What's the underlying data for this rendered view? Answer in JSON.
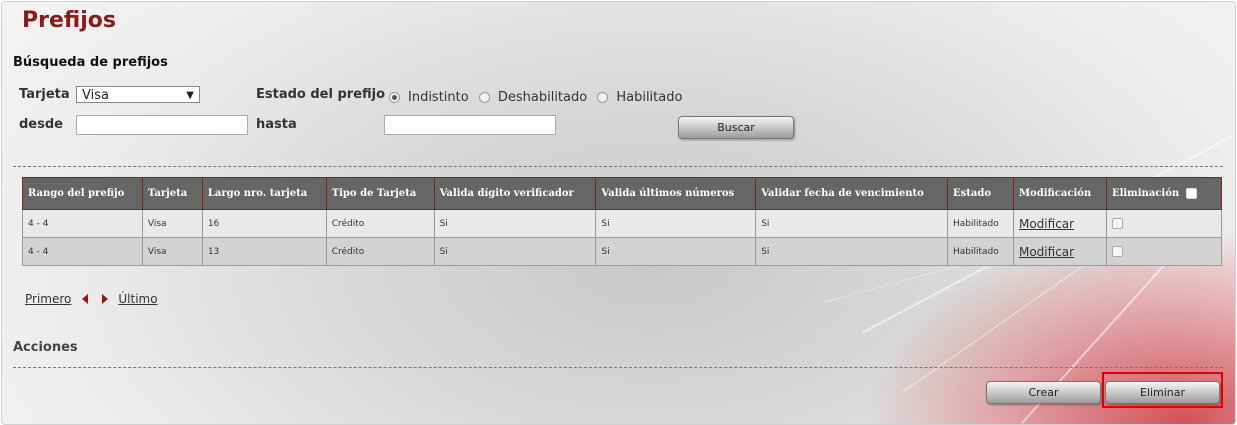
{
  "page_title": "Prefijos",
  "search": {
    "heading": "Búsqueda de prefijos",
    "tarjeta_label": "Tarjeta",
    "tarjeta_value": "Visa",
    "estado_label": "Estado del prefijo",
    "estado_options": [
      "Indistinto",
      "Deshabilitado",
      "Habilitado"
    ],
    "estado_selected": "Indistinto",
    "desde_label": "desde",
    "hasta_label": "hasta",
    "desde_value": "",
    "hasta_value": "",
    "buscar_label": "Buscar"
  },
  "table": {
    "headers": [
      "Rango del prefijo",
      "Tarjeta",
      "Largo nro. tarjeta",
      "Tipo de Tarjeta",
      "Valida dígito verificador",
      "Valida últimos números",
      "Validar fecha de vencimiento",
      "Estado",
      "Modificación",
      "Eliminación"
    ],
    "rows": [
      [
        "4 - 4",
        "Visa",
        "16",
        "Crédito",
        "Si",
        "Si",
        "Si",
        "Habilitado",
        "Modificar"
      ],
      [
        "4 - 4",
        "Visa",
        "13",
        "Crédito",
        "Si",
        "Si",
        "Si",
        "Habilitado",
        "Modificar"
      ]
    ]
  },
  "pager": {
    "first": "Primero",
    "last": "Último"
  },
  "actions": {
    "heading": "Acciones",
    "crear_label": "Crear",
    "eliminar_label": "Eliminar"
  },
  "colors": {
    "title": "#8b1a1a",
    "highlight": "#e00000",
    "header_bg": "#666666"
  }
}
